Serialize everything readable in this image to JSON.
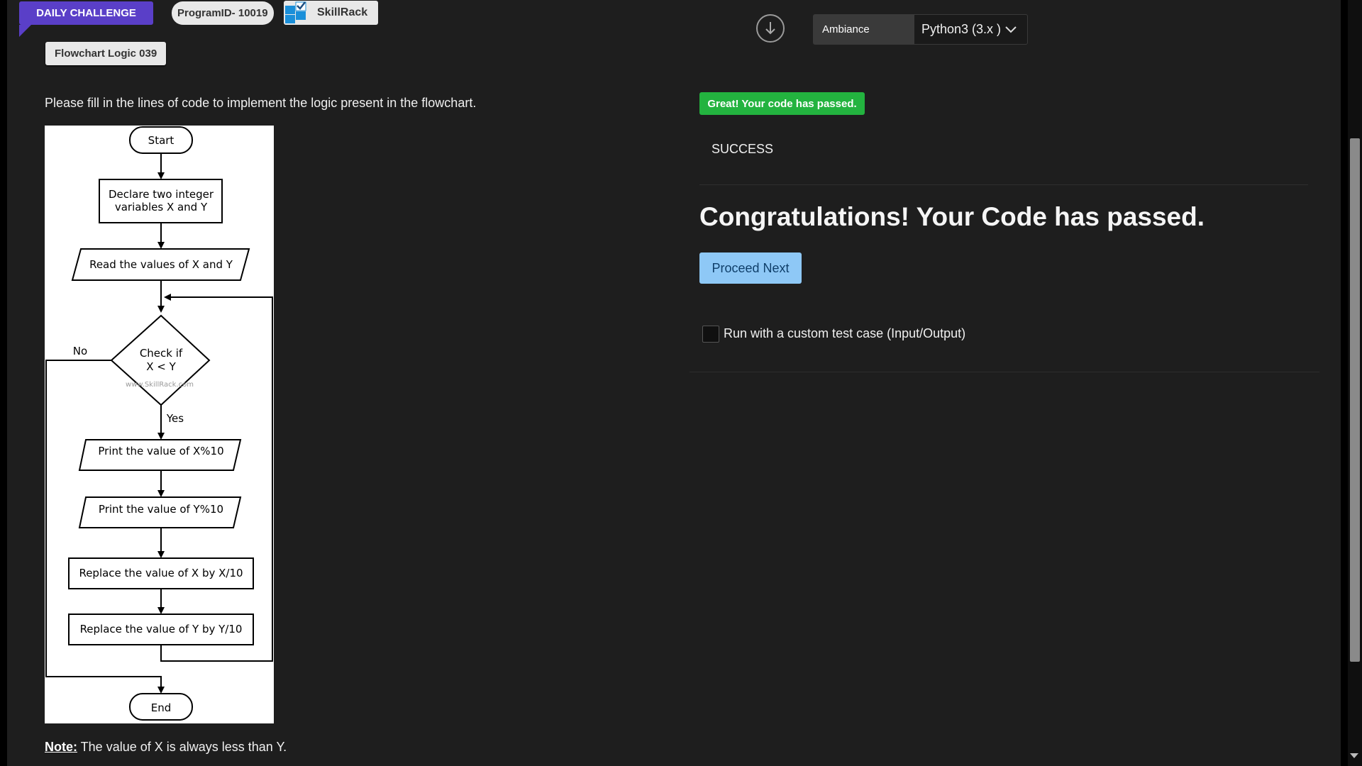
{
  "header": {
    "daily_challenge": "DAILY CHALLENGE",
    "program_id": "ProgramID- 10019",
    "brand": "SkillRack",
    "topic": "Flowchart Logic 039"
  },
  "problem": {
    "instruction": "Please fill in the lines of code to implement the logic present in the flowchart.",
    "note_label": "Note:",
    "note_text": " The value of X is always less than Y."
  },
  "flowchart": {
    "start": "Start",
    "declare_1": "Declare two integer",
    "declare_2": "variables X and Y",
    "read": "Read the values of X and Y",
    "check_1": "Check if",
    "check_2": "X < Y",
    "watermark": "www.SkillRack.com",
    "no": "No",
    "yes": "Yes",
    "print_x": "Print the value of X%10",
    "print_y": "Print the value of Y%10",
    "replace_x": "Replace the value of X by X/10",
    "replace_y": "Replace the value of Y by Y/10",
    "end": "End"
  },
  "editor": {
    "ambiance_label": "Ambiance",
    "language": "Python3 (3.x )"
  },
  "result": {
    "pass_badge": "Great! Your code has passed.",
    "status": "SUCCESS",
    "congrats": "Congratulations! Your Code has passed.",
    "proceed": "Proceed Next",
    "custom_test": "Run with a custom test case (Input/Output)"
  },
  "colors": {
    "accent_purple": "#5a3fc8",
    "success_green": "#23b33f",
    "proceed_blue": "#8ec8f6",
    "background": "#1e1e1e"
  }
}
